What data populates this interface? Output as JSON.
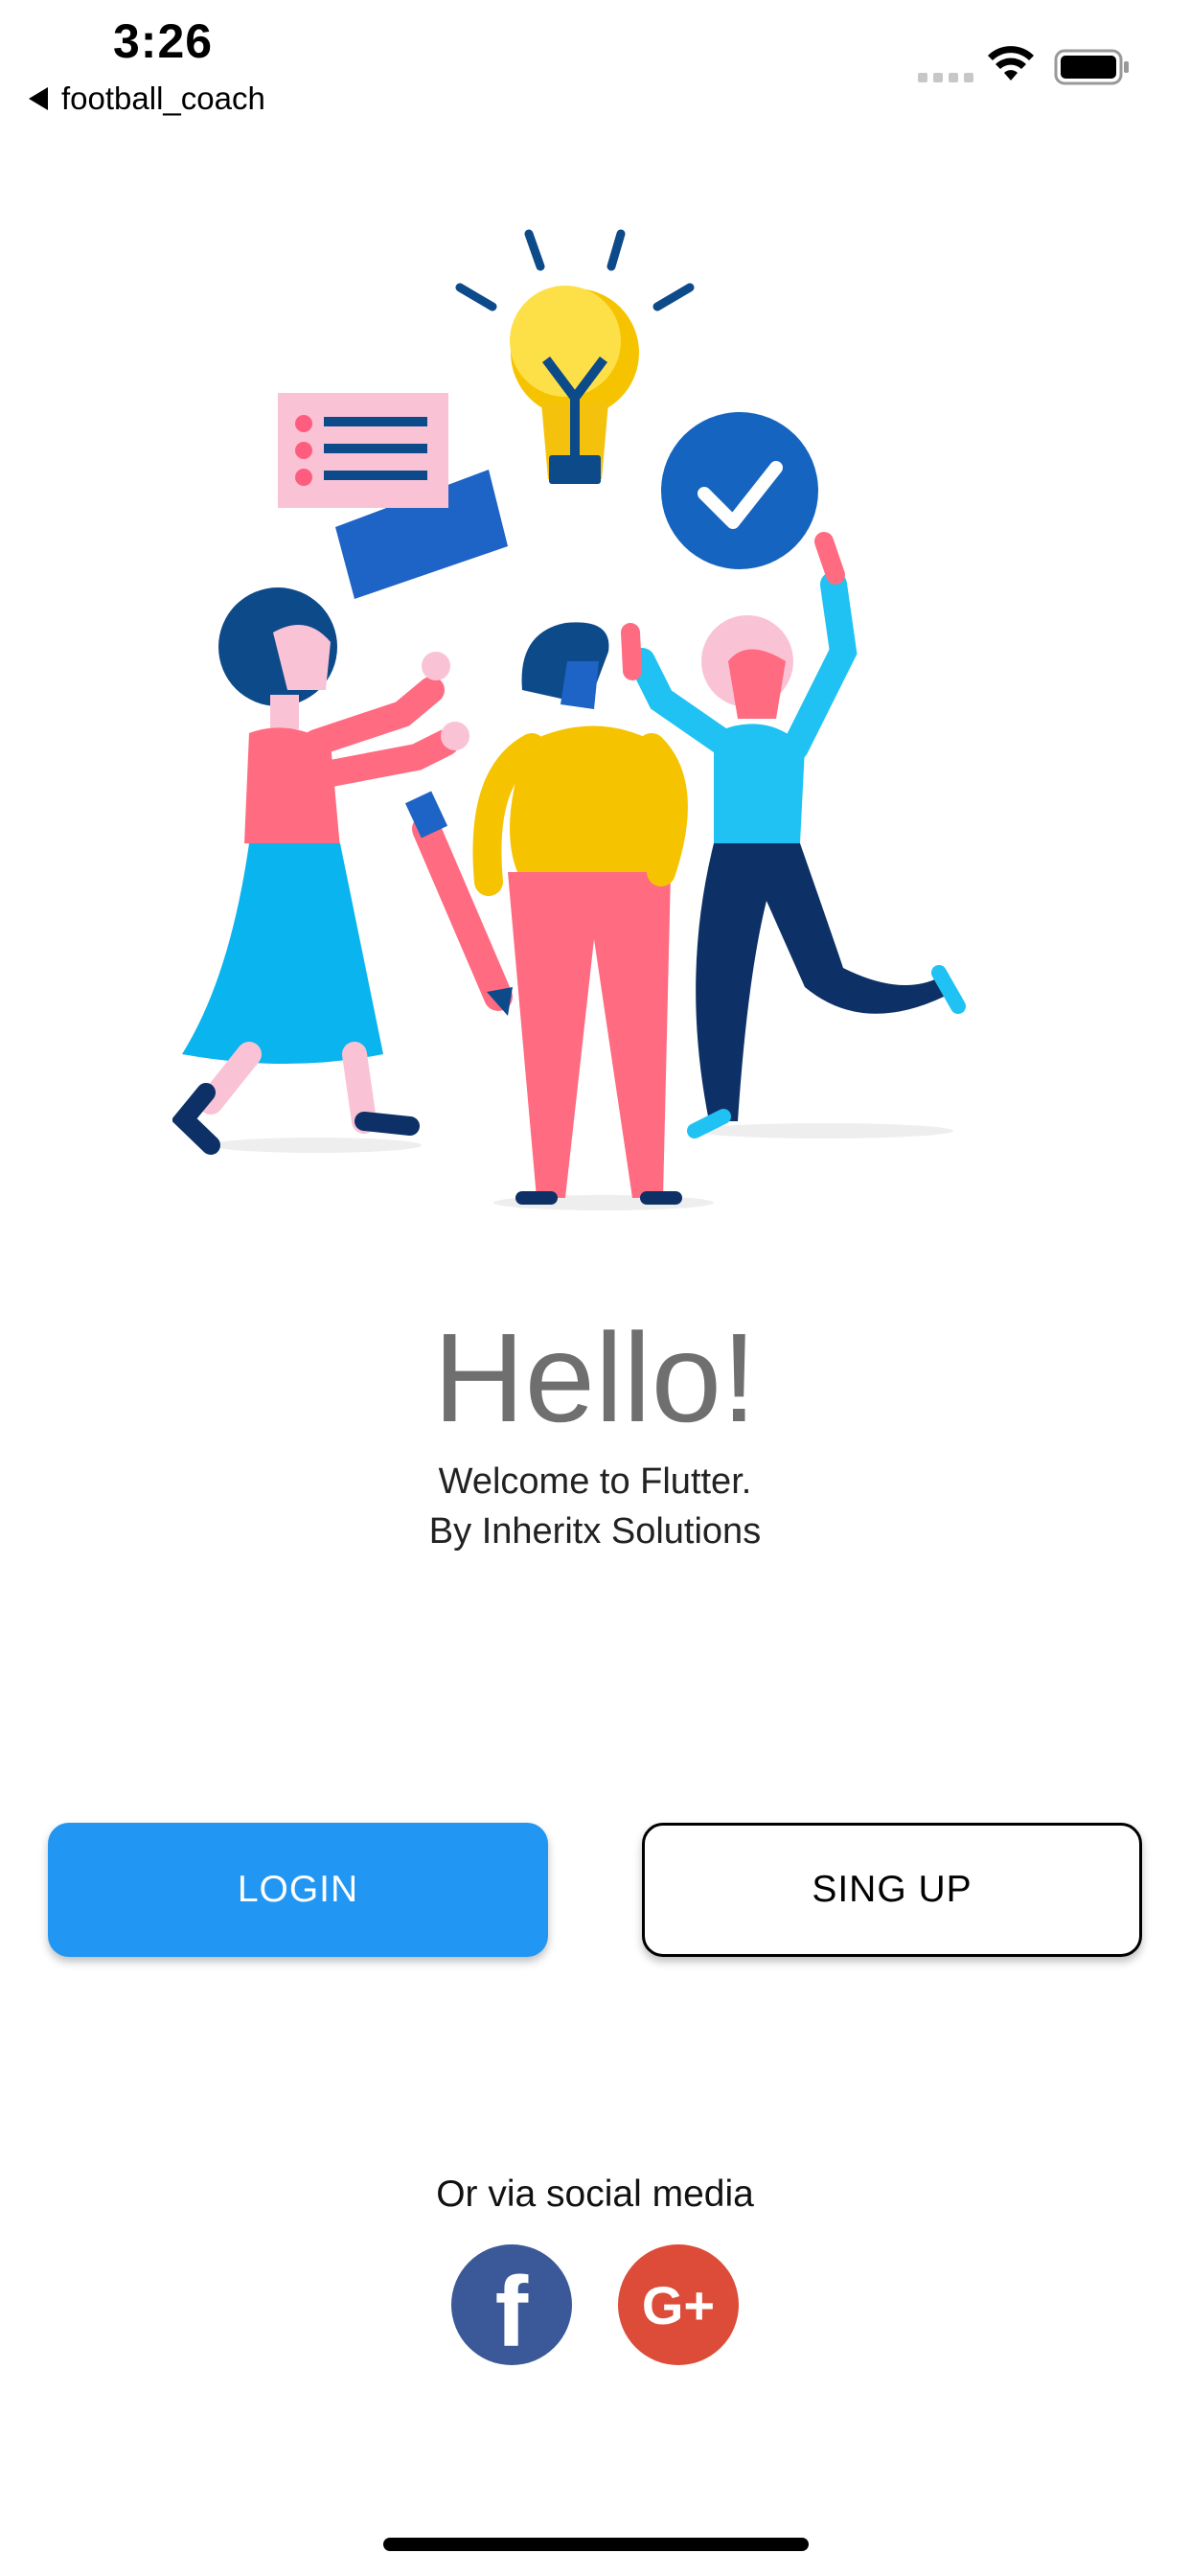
{
  "status_bar": {
    "time": "3:26",
    "back_app": "football_coach"
  },
  "greeting": {
    "title": "Hello!",
    "line1": "Welcome to Flutter.",
    "line2": "By Inheritx Solutions"
  },
  "buttons": {
    "login": "LOGIN",
    "signup": "SING UP"
  },
  "social": {
    "label": "Or via social media",
    "facebook_glyph": "f",
    "google_glyph": "G+"
  },
  "colors": {
    "primary": "#2196f3",
    "facebook": "#3b5998",
    "google": "#dd4b39",
    "hello_text": "#6f6f6f"
  }
}
